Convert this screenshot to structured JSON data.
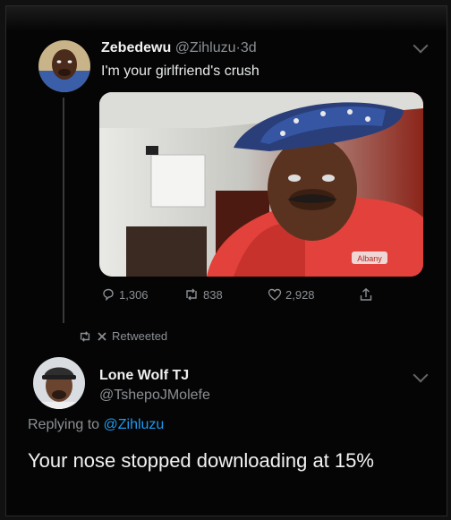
{
  "tweet1": {
    "display_name": "Zebedewu",
    "handle": "@Zihluzu",
    "separator": "·",
    "time": "3d",
    "text": "I'm your girlfriend's crush",
    "media_shirt_text": "Albany",
    "reply_count": "1,306",
    "retweet_count": "838",
    "like_count": "2,928",
    "icons": {
      "reply": "reply-icon",
      "retweet": "retweet-icon",
      "like": "heart-icon",
      "share": "share-icon",
      "more": "chevron-down-icon"
    }
  },
  "retweet_bar": {
    "label": "Retweeted",
    "icons": [
      "retweet-icon",
      "close-icon"
    ]
  },
  "tweet2": {
    "display_name": "Lone Wolf TJ",
    "handle": "@TshepoJMolefe",
    "replying_prefix": "Replying to",
    "replying_to": "@Zihluzu",
    "text": "Your nose stopped downloading at 15%"
  },
  "colors": {
    "background": "#050505",
    "link": "#1d9bf0",
    "muted": "#8b8f94",
    "text": "#e7e9ea"
  }
}
